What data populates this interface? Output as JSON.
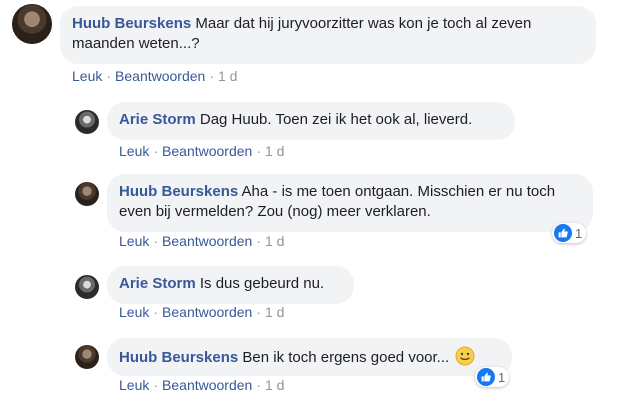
{
  "comments": [
    {
      "author": "Huub Beurskens",
      "text": "Maar dat hij juryvoorzitter was kon je toch al zeven maanden weten...?",
      "like_label": "Leuk",
      "reply_label": "Beantwoorden",
      "time": "1 d"
    },
    {
      "author": "Arie Storm",
      "text": "Dag Huub. Toen zei ik het ook al, lieverd.",
      "like_label": "Leuk",
      "reply_label": "Beantwoorden",
      "time": "1 d"
    },
    {
      "author": "Huub Beurskens",
      "text": "Aha - is me toen ontgaan. Misschien er nu toch even bij vermelden? Zou (nog) meer verklaren.",
      "like_label": "Leuk",
      "reply_label": "Beantwoorden",
      "time": "1 d",
      "reaction_icon": "like-icon",
      "reaction_count": "1"
    },
    {
      "author": "Arie Storm",
      "text": "Is dus gebeurd nu.",
      "like_label": "Leuk",
      "reply_label": "Beantwoorden",
      "time": "1 d"
    },
    {
      "author": "Huub Beurskens",
      "text": "Ben ik toch ergens goed voor...",
      "emoji": "slightly-smiling-face-icon",
      "like_label": "Leuk",
      "reply_label": "Beantwoorden",
      "time": "1 d",
      "reaction_icon": "like-icon",
      "reaction_count": "1"
    }
  ],
  "separator": "·",
  "colors": {
    "author": "#385898",
    "bubble": "#f2f3f5",
    "meta_gray": "#90949c",
    "like_blue": "#1877f2"
  }
}
